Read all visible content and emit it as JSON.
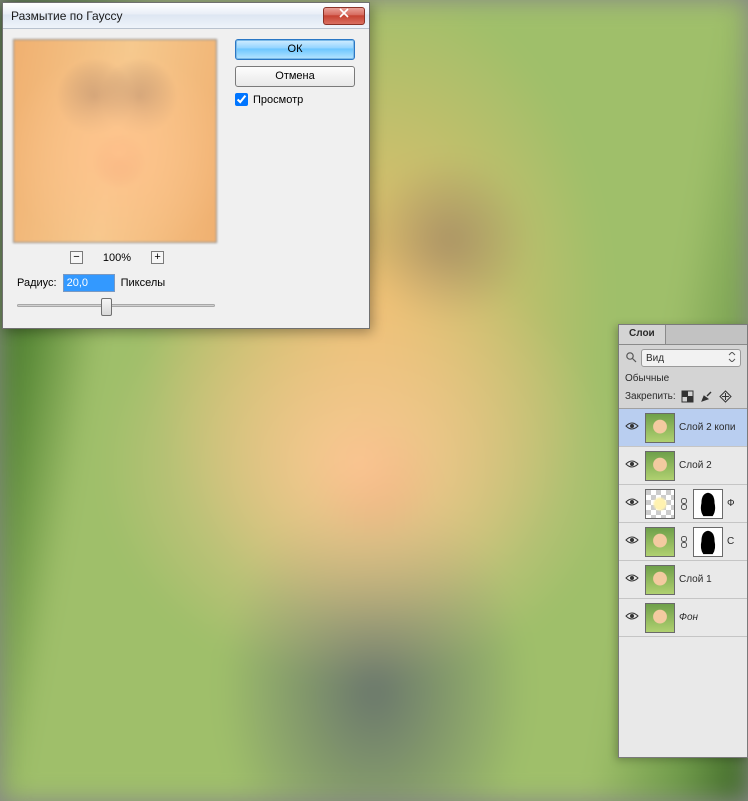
{
  "dialog": {
    "title": "Размытие по Гауссу",
    "ok_label": "ОК",
    "cancel_label": "Отмена",
    "preview_label": "Просмотр",
    "preview_checked": true,
    "zoom_minus": "−",
    "zoom_pct": "100%",
    "zoom_plus": "+",
    "radius_label": "Радиус:",
    "radius_value": "20,0",
    "radius_units": "Пикселы"
  },
  "panel": {
    "tab_label": "Слои",
    "kind_label": "Вид",
    "blend_mode": "Обычные",
    "lock_label": "Закрепить:",
    "layers": [
      {
        "name": "Слой 2 копи",
        "selected": true,
        "thumb": "photo",
        "italic": false
      },
      {
        "name": "Слой 2",
        "selected": false,
        "thumb": "photo",
        "italic": false
      },
      {
        "name": "Ф",
        "selected": false,
        "thumb": "checker",
        "mask": true,
        "italic": false
      },
      {
        "name": "С",
        "selected": false,
        "thumb": "photo",
        "mask": true,
        "italic": false
      },
      {
        "name": "Слой 1",
        "selected": false,
        "thumb": "photo",
        "italic": false
      },
      {
        "name": "Фон",
        "selected": false,
        "thumb": "photo",
        "italic": true
      }
    ]
  }
}
